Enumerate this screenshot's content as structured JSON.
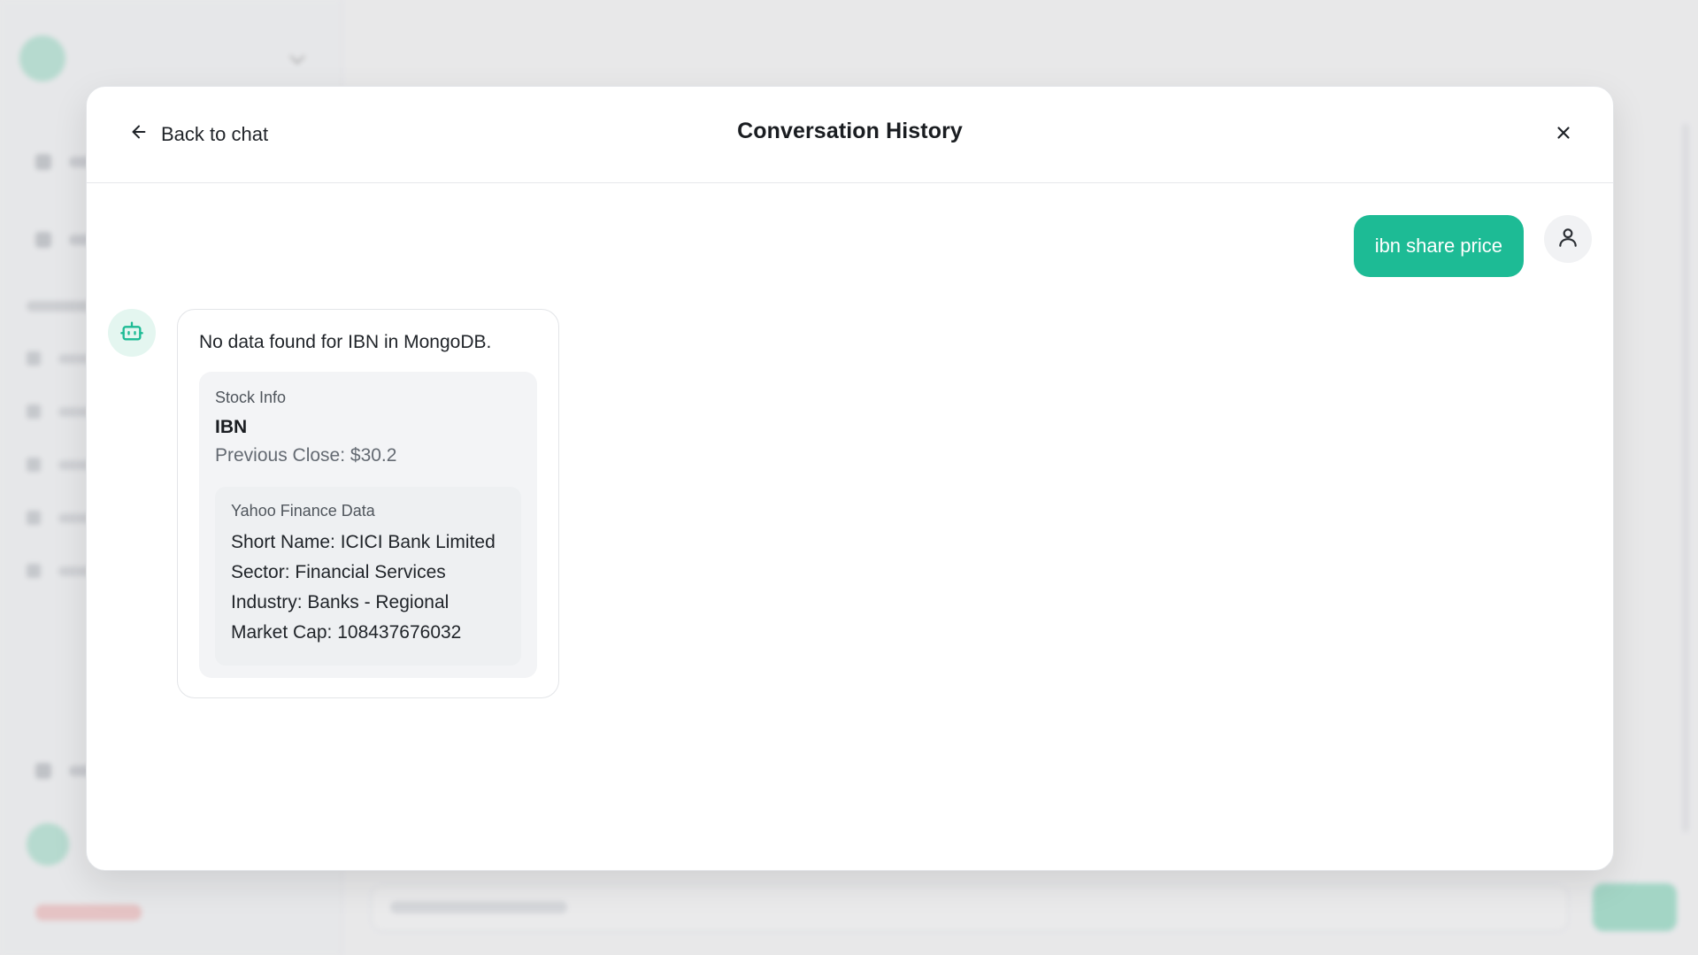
{
  "modal": {
    "back_label": "Back to chat",
    "title": "Conversation History"
  },
  "user_message": {
    "text": "ibn share price"
  },
  "bot_message": {
    "text": "No data found for IBN in MongoDB.",
    "stock_info": {
      "label": "Stock Info",
      "symbol": "IBN",
      "previous_close": "Previous Close: $30.2"
    },
    "yahoo": {
      "title": "Yahoo Finance Data",
      "short_name": "Short Name: ICICI Bank Limited",
      "sector": "Sector: Financial Services",
      "industry": "Industry: Banks - Regional",
      "market_cap": "Market Cap: 108437676032"
    }
  },
  "colors": {
    "accent": "#1dbb95",
    "bot_avatar_bg": "#e4f6f0"
  },
  "icons": {
    "back": "arrow-left-icon",
    "close": "close-icon",
    "user": "user-icon",
    "bot": "bot-icon"
  }
}
